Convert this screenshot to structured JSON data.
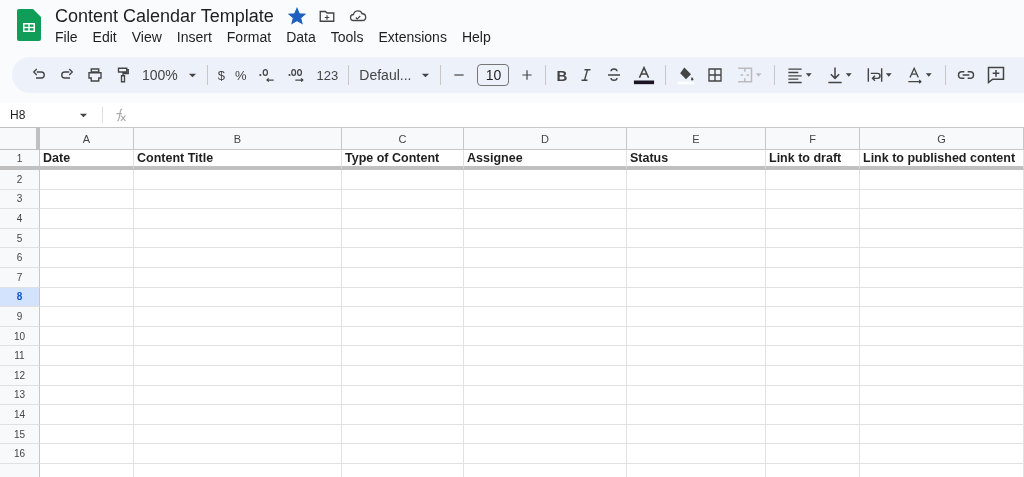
{
  "document": {
    "title": "Content Calendar Template",
    "starred": true
  },
  "menu": [
    "File",
    "Edit",
    "View",
    "Insert",
    "Format",
    "Data",
    "Tools",
    "Extensions",
    "Help"
  ],
  "toolbar": [
    {
      "kind": "undo"
    },
    {
      "kind": "redo"
    },
    {
      "kind": "print"
    },
    {
      "kind": "paint"
    },
    {
      "kind": "dropdown",
      "text": "100%"
    },
    {
      "kind": "divider"
    },
    {
      "kind": "text",
      "text": "$"
    },
    {
      "kind": "text",
      "text": "%"
    },
    {
      "kind": "decrease-decimal"
    },
    {
      "kind": "increase-decimal"
    },
    {
      "kind": "text",
      "text": "123"
    },
    {
      "kind": "divider"
    },
    {
      "kind": "dropdown",
      "text": "Defaul..."
    },
    {
      "kind": "divider"
    },
    {
      "kind": "minus"
    },
    {
      "kind": "size",
      "text": "10"
    },
    {
      "kind": "plus"
    },
    {
      "kind": "divider"
    },
    {
      "kind": "bold",
      "text": "B"
    },
    {
      "kind": "italic"
    },
    {
      "kind": "strike"
    },
    {
      "kind": "text-color"
    },
    {
      "kind": "divider"
    },
    {
      "kind": "fill"
    },
    {
      "kind": "borders"
    },
    {
      "kind": "merge",
      "disabled": true
    },
    {
      "kind": "divider"
    },
    {
      "kind": "align"
    },
    {
      "kind": "valign"
    },
    {
      "kind": "wrap"
    },
    {
      "kind": "rotate"
    },
    {
      "kind": "divider"
    },
    {
      "kind": "link"
    },
    {
      "kind": "comment"
    }
  ],
  "name_box": "H8",
  "sheet": {
    "columns": [
      {
        "label": "A",
        "header": "Date"
      },
      {
        "label": "B",
        "header": "Content Title"
      },
      {
        "label": "C",
        "header": "Type of Content"
      },
      {
        "label": "D",
        "header": "Assignee"
      },
      {
        "label": "E",
        "header": "Status"
      },
      {
        "label": "F",
        "header": "Link to draft"
      },
      {
        "label": "G",
        "header": "Link to published content"
      }
    ],
    "rows": [
      {
        "label": "1",
        "selected": false
      },
      {
        "label": "2",
        "selected": false
      },
      {
        "label": "3",
        "selected": false
      },
      {
        "label": "4",
        "selected": false
      },
      {
        "label": "5",
        "selected": false
      },
      {
        "label": "6",
        "selected": false
      },
      {
        "label": "7",
        "selected": false
      },
      {
        "label": "8",
        "selected": true
      },
      {
        "label": "9",
        "selected": false
      },
      {
        "label": "10",
        "selected": false
      },
      {
        "label": "11",
        "selected": false
      },
      {
        "label": "12",
        "selected": false
      },
      {
        "label": "13",
        "selected": false
      },
      {
        "label": "14",
        "selected": false
      },
      {
        "label": "15",
        "selected": false
      },
      {
        "label": "16",
        "selected": false
      }
    ]
  }
}
